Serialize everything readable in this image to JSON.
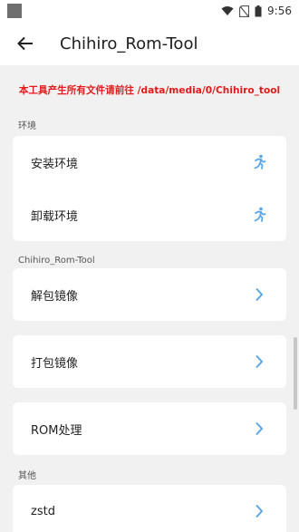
{
  "status_bar": {
    "time": "9:56"
  },
  "app_bar": {
    "title": "Chihiro_Rom-Tool"
  },
  "notice": "本工具产生所有文件请前往 /data/media/0/Chihiro_tool",
  "sections": [
    {
      "label": "环境",
      "items": [
        {
          "label": "安装环境",
          "icon": "running-person-icon"
        },
        {
          "label": "卸载环境",
          "icon": "running-person-icon"
        }
      ]
    },
    {
      "label": "Chihiro_Rom-Tool",
      "items": [
        {
          "label": "解包镜像",
          "icon": "chevron-right-icon"
        },
        {
          "label": "打包镜像",
          "icon": "chevron-right-icon"
        },
        {
          "label": "ROM处理",
          "icon": "chevron-right-icon"
        }
      ]
    },
    {
      "label": "其他",
      "items": [
        {
          "label": "zstd",
          "icon": "chevron-right-icon"
        }
      ]
    }
  ],
  "colors": {
    "accent_icon": "#5aa8e8",
    "notice": "#e21b1b",
    "background": "#f1f1f1"
  }
}
